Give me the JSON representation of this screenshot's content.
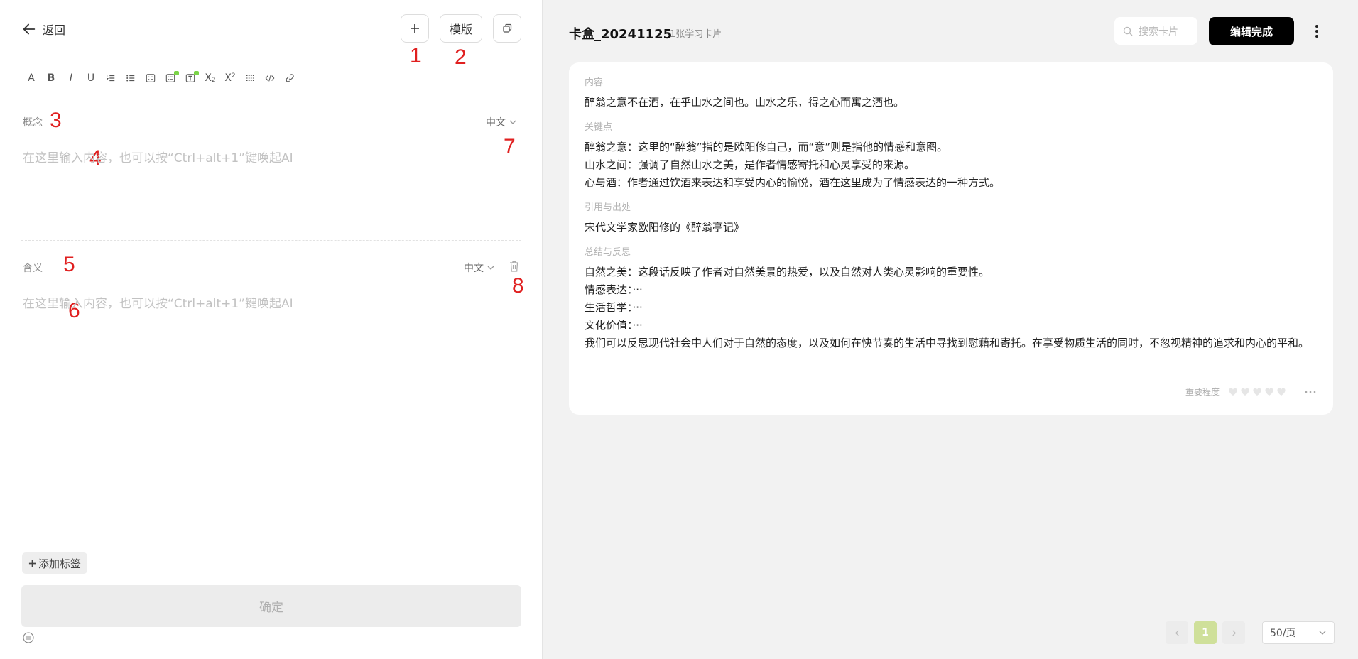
{
  "left": {
    "back_label": "返回",
    "toolbar": {
      "add_label": "+",
      "template_label": "模版"
    },
    "annotations": [
      "1",
      "2",
      "3",
      "4",
      "5",
      "6",
      "7",
      "8"
    ],
    "format_bar": [
      "A",
      "B",
      "I",
      "U",
      "ol",
      "ul",
      "task",
      "ai-task",
      "ai-text",
      "X₂",
      "X²",
      "hr",
      "code",
      "link"
    ],
    "concept": {
      "label": "概念",
      "lang": "中文",
      "placeholder": "在这里输入内容，也可以按“Ctrl+alt+1”键唤起AI"
    },
    "meaning": {
      "label": "含义",
      "lang": "中文",
      "placeholder": "在这里输入内容，也可以按“Ctrl+alt+1”键唤起AI"
    },
    "add_tag_label": "添加标签",
    "confirm_label": "确定"
  },
  "right": {
    "title": "卡盒_20241125",
    "count": "1张学习卡片",
    "search_placeholder": "搜索卡片",
    "done_label": "编辑完成",
    "card": {
      "sections": [
        {
          "heading": "内容",
          "lines": [
            "醉翁之意不在酒，在乎山水之间也。山水之乐，得之心而寓之酒也。"
          ]
        },
        {
          "heading": "关键点",
          "lines": [
            "醉翁之意：这里的“醉翁”指的是欧阳修自己，而“意”则是指他的情感和意图。",
            "山水之间：强调了自然山水之美，是作者情感寄托和心灵享受的来源。",
            "心与酒：作者通过饮酒来表达和享受内心的愉悦，酒在这里成为了情感表达的一种方式。"
          ]
        },
        {
          "heading": "引用与出处",
          "lines": [
            "宋代文学家欧阳修的《醉翁亭记》"
          ]
        },
        {
          "heading": "总结与反思",
          "lines": [
            "自然之美：这段话反映了作者对自然美景的热爱，以及自然对人类心灵影响的重要性。",
            "情感表达：···",
            "生活哲学：···",
            "文化价值：···",
            "我们可以反思现代社会中人们对于自然的态度，以及如何在快节奏的生活中寻找到慰藉和寄托。在享受物质生活的同时，不忽视精神的追求和内心的平和。"
          ]
        }
      ],
      "importance_label": "重要程度",
      "importance_value": 0
    },
    "pagination": {
      "current": "1",
      "page_size": "50/页"
    }
  }
}
